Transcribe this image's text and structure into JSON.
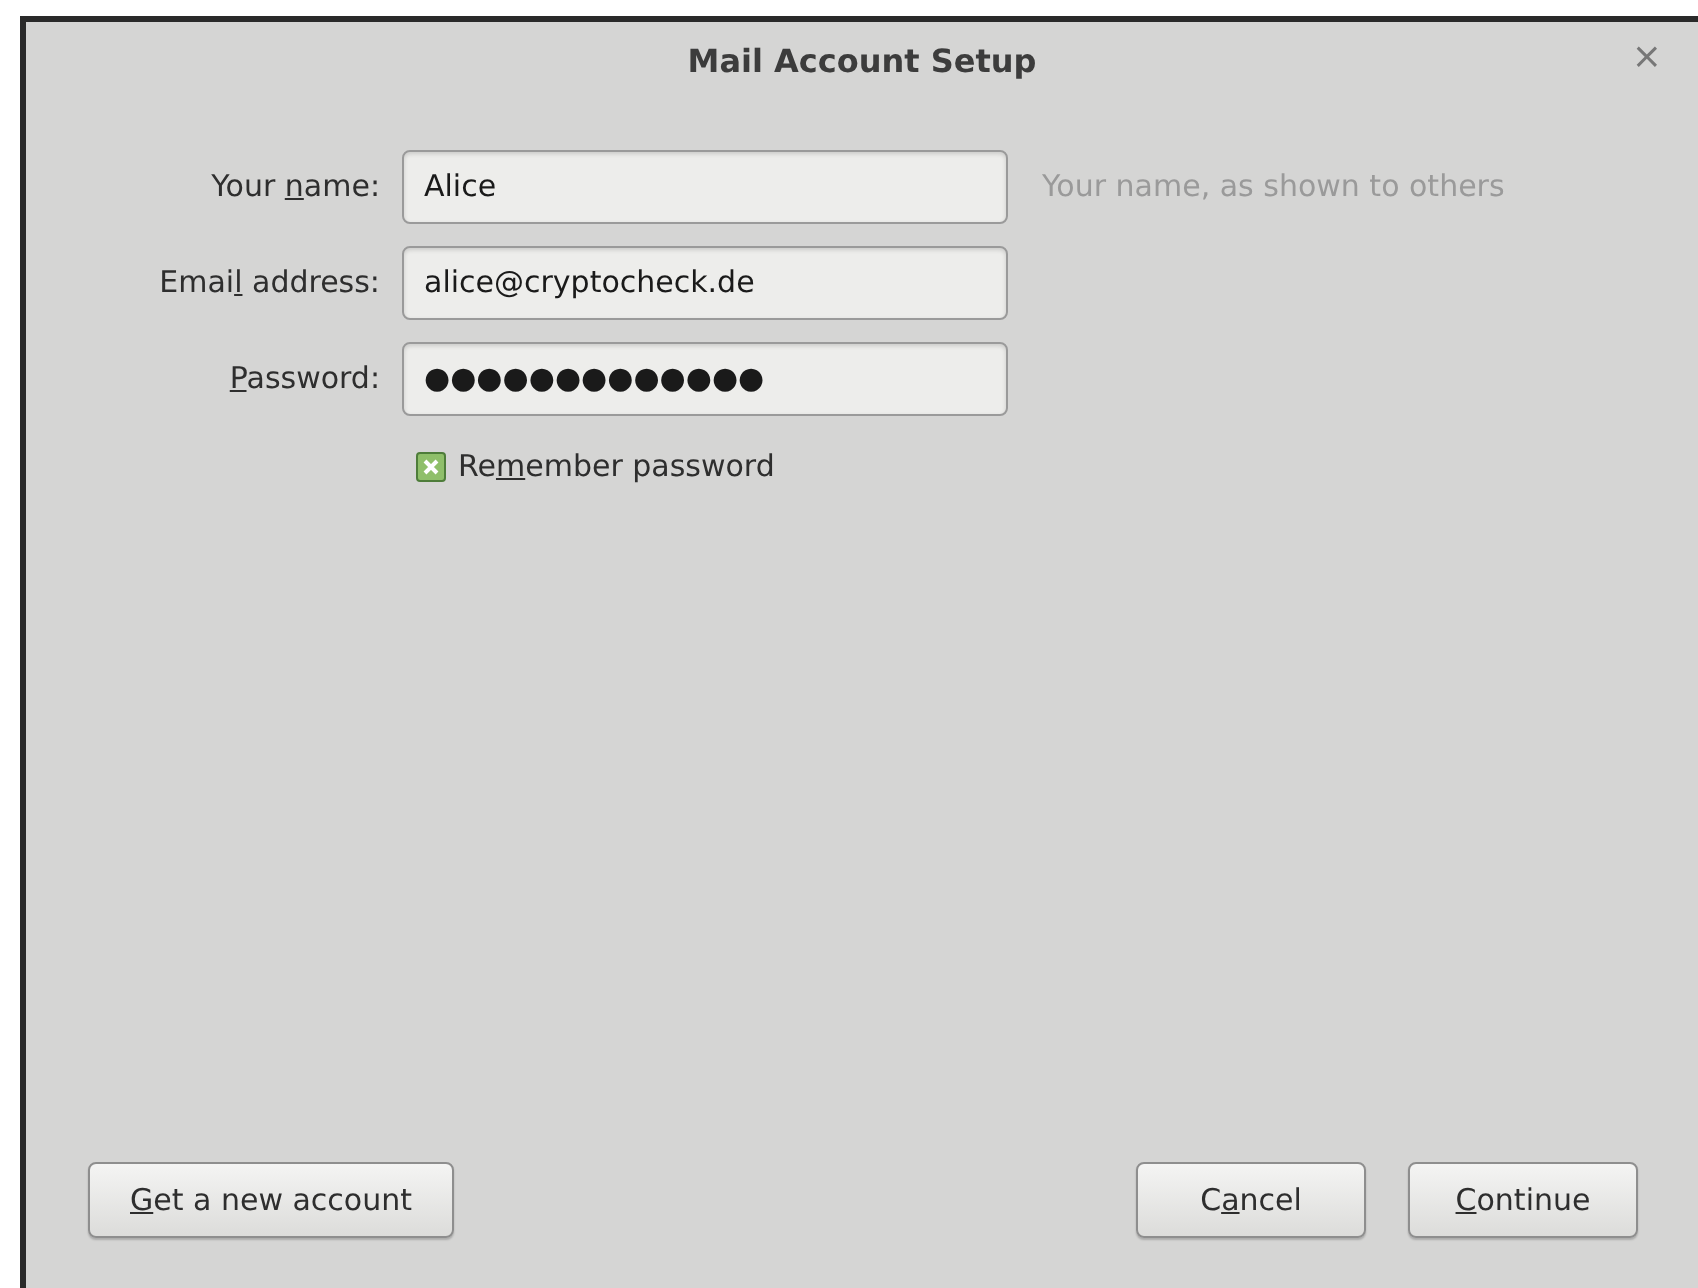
{
  "window": {
    "title": "Mail Account Setup",
    "close": "×"
  },
  "fields": [
    {
      "label": {
        "before": "Your ",
        "key": "n",
        "after": "ame:"
      },
      "value": "Alice",
      "hint": "Your name, as shown to others"
    },
    {
      "label": {
        "before": "Emai",
        "key": "l",
        "after": " address:"
      },
      "value": "alice@cryptocheck.de"
    },
    {
      "label": {
        "key": "P",
        "after": "assword:"
      },
      "value": "●●●●●●●●●●●●●"
    }
  ],
  "remember": {
    "label": {
      "before": "Re",
      "key": "m",
      "after": "ember password"
    },
    "checked": true
  },
  "buttons": [
    {
      "label": {
        "key": "G",
        "after": "et a new account"
      },
      "kind": "left"
    },
    {
      "label": {
        "before": "C",
        "key": "a",
        "after": "ncel"
      },
      "kind": "right"
    },
    {
      "label": {
        "key": "C",
        "after": "ontinue"
      },
      "kind": "right"
    }
  ]
}
